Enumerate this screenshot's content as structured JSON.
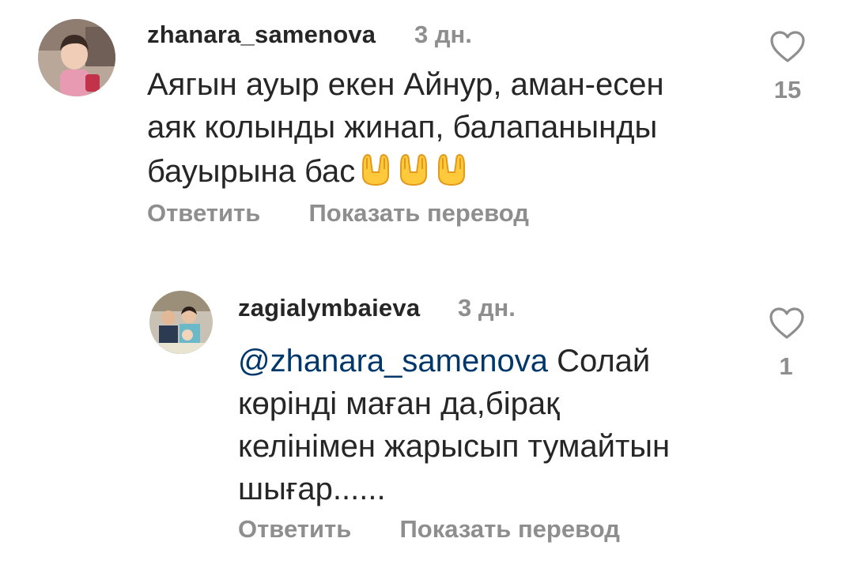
{
  "comments": [
    {
      "username": "zhanara_samenova",
      "time": "3 дн.",
      "text_lines": [
        "Аягын ауыр екен Айнур, аман-есен",
        "аяк колынды жинап, балапанынды",
        "бауырына бас"
      ],
      "emoji": [
        "🤲",
        "🤲",
        "🤲"
      ],
      "reply_label": "Ответить",
      "translate_label": "Показать перевод",
      "likes": "15",
      "avatar_icon": "user-avatar-child-photo"
    },
    {
      "username": "zagialymbaieva",
      "time": "3 дн.",
      "mention": "@zhanara_samenova",
      "text_first_line_rest": " Солай",
      "text_lines": [
        "көрінді маған да,бірақ",
        "келінімен жарысып тумайтын",
        "шығар......"
      ],
      "reply_label": "Ответить",
      "translate_label": "Показать перевод",
      "likes": "1",
      "avatar_icon": "user-avatar-family-photo"
    }
  ],
  "colors": {
    "text": "#262626",
    "secondary": "#8e8e8e",
    "mention": "#00376b",
    "heart_stroke": "#8e8e8e"
  }
}
